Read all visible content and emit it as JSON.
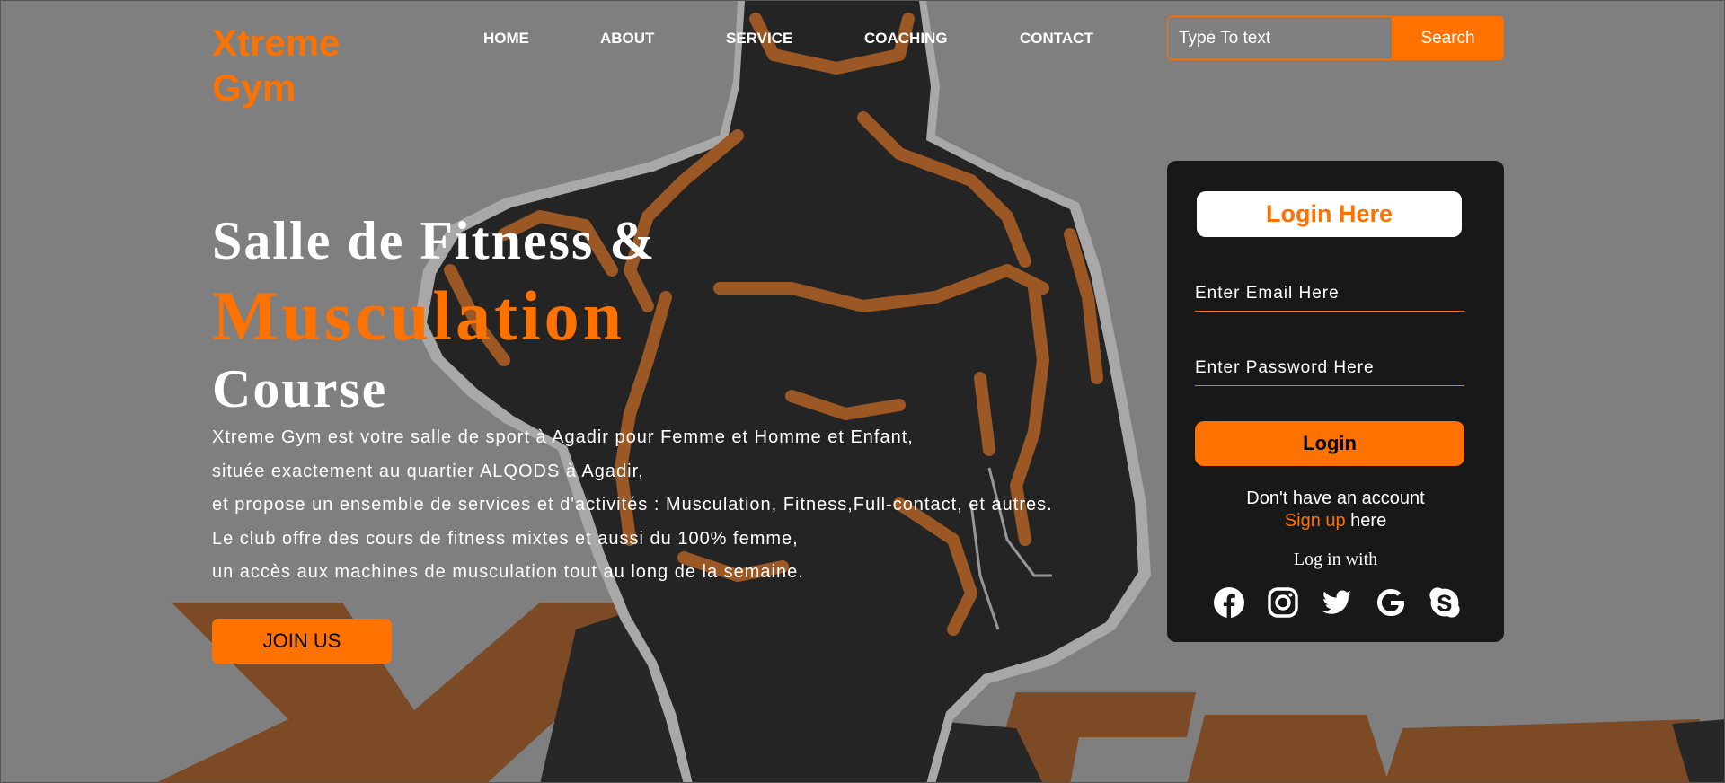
{
  "header": {
    "logo_line1": "Xtreme",
    "logo_line2": "Gym",
    "nav": [
      {
        "label": "HOME"
      },
      {
        "label": "ABOUT"
      },
      {
        "label": "SERVICE"
      },
      {
        "label": "COACHING"
      },
      {
        "label": "CONTACT"
      }
    ],
    "search": {
      "placeholder": "Type To text",
      "button_label": "Search"
    }
  },
  "hero": {
    "title_line1": "Salle de Fitness &",
    "title_line2": "Musculation",
    "title_line3": "Course",
    "description": [
      "Xtreme Gym est votre salle de sport à Agadir pour Femme et Homme et Enfant,",
      "située exactement au quartier ALQODS à Agadir,",
      "et propose un ensemble de services et d'activités : Musculation, Fitness,Full-contact, et autres.",
      "Le club offre des cours de fitness mixtes et aussi du 100% femme,",
      "un accès aux machines de musculation tout au long de la semaine."
    ],
    "join_button": "JOIN US"
  },
  "login": {
    "heading": "Login Here",
    "email_placeholder": "Enter Email Here",
    "password_placeholder": "Enter Password Here",
    "button_label": "Login",
    "no_account_text": "Don't have an account",
    "signup_link": "Sign up",
    "signup_suffix": " here",
    "login_with": "Log in with",
    "social_icons": [
      "facebook-icon",
      "instagram-icon",
      "twitter-icon",
      "google-icon",
      "skype-icon"
    ]
  },
  "colors": {
    "accent": "#ff7200",
    "background": "#808080",
    "panel": "#181818",
    "text": "#ffffff"
  }
}
